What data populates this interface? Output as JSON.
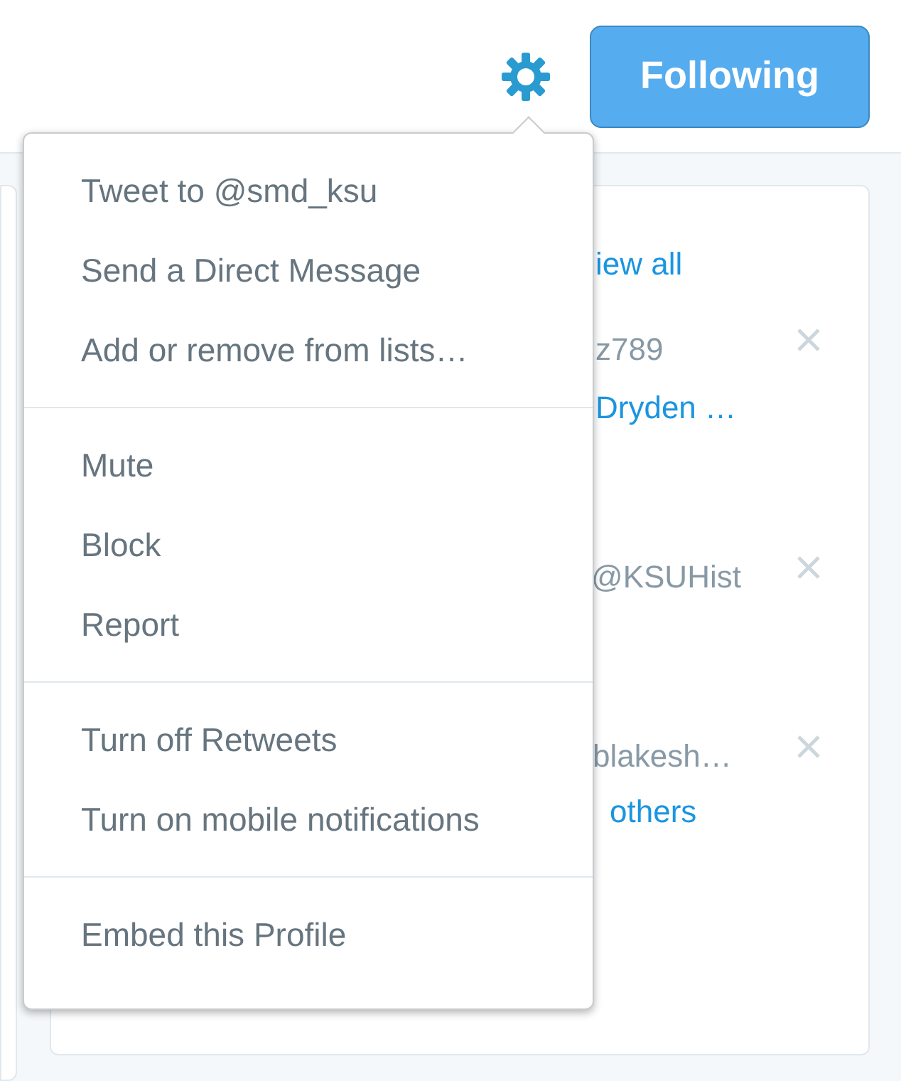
{
  "header": {
    "follow_button": "Following"
  },
  "menu": {
    "groups": [
      [
        "Tweet to @smd_ksu",
        "Send a Direct Message",
        "Add or remove from lists…"
      ],
      [
        "Mute",
        "Block",
        "Report"
      ],
      [
        "Turn off Retweets",
        "Turn on mobile notifications"
      ],
      [
        "Embed this Profile"
      ]
    ]
  },
  "who_to_follow": {
    "view_all": "iew all",
    "suggestions": [
      {
        "handle": "z789",
        "followed_by": "Dryden …"
      },
      {
        "handle": "@KSUHist"
      },
      {
        "handle": "blakesh…",
        "followed_by": "others"
      }
    ]
  }
}
